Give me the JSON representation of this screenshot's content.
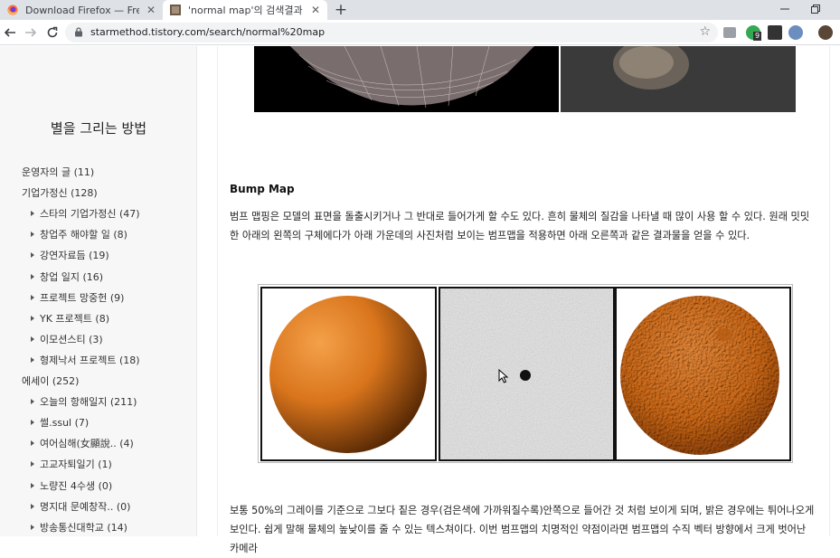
{
  "browser": {
    "tabs": [
      {
        "title": "Download Firefox — Free Web",
        "close": "✕"
      },
      {
        "title": "'normal map'의 검색결과 :: 별을",
        "close": "✕"
      }
    ],
    "new_tab": "+",
    "url": "starmethod.tistory.com/search/normal%20map",
    "extension_badge": "9",
    "colors": {
      "tabstrip": "#dee1e6",
      "active_tab": "#ffffff",
      "omnibox": "#f1f3f4"
    }
  },
  "sidebar": {
    "blog_title": "별을 그리는 방법",
    "categories": [
      {
        "label": "운영자의 글 (11)",
        "sub": false
      },
      {
        "label": "기업가정신 (128)",
        "sub": false
      },
      {
        "label": "스타의 기업가정신 (47)",
        "sub": true
      },
      {
        "label": "창업주 해야할 일 (8)",
        "sub": true
      },
      {
        "label": "강연자료듬 (19)",
        "sub": true
      },
      {
        "label": "창업 일지 (16)",
        "sub": true
      },
      {
        "label": "프로젝트 망중헌 (9)",
        "sub": true
      },
      {
        "label": "YK 프로젝트 (8)",
        "sub": true
      },
      {
        "label": "이모션스티 (3)",
        "sub": true
      },
      {
        "label": "형제낙서 프로젝트 (18)",
        "sub": true
      },
      {
        "label": "에세이 (252)",
        "sub": false
      },
      {
        "label": "오늘의 항해일지 (211)",
        "sub": true
      },
      {
        "label": "썰.ssul (7)",
        "sub": true
      },
      {
        "label": "여어심해(女顯說.. (4)",
        "sub": true
      },
      {
        "label": "고교자퇴일기 (1)",
        "sub": true
      },
      {
        "label": "노량진 4수생 (0)",
        "sub": true
      },
      {
        "label": "명지대 문예창작.. (0)",
        "sub": true
      },
      {
        "label": "방송통신대학교 (14)",
        "sub": true
      }
    ]
  },
  "article": {
    "section_title": "Bump Map",
    "para1": "범프 맵핑은 모델의 표면을 돌출시키거나 그 반대로 들어가게 할 수도 있다. 흔히 물체의 질감을 나타낼 때 많이 사용 할 수 있다. 원래 밋밋한 아래의 왼쪽의 구체에다가 아래 가운데의 사진처럼 보이는 범프맵을 적용하면 아래 오른쪽과 같은 결과물을 얻을 수 있다.",
    "para2": "보통 50%의 그레이를 기준으로 그보다 짙은 경우(검은색에 가까워질수록)안쪽으로 들어간 것 처럼 보이게 되며, 밝은 경우에는 튀어나오게 보인다. 쉽게 말해 물체의 높낮이를 줄 수 있는 텍스쳐이다. 이번 범프맵의 치명적인 약점이라면 범프맵의 수직 벡터 방향에서 크게 벗어난 카메라",
    "sphere_color": "#d9751c"
  }
}
